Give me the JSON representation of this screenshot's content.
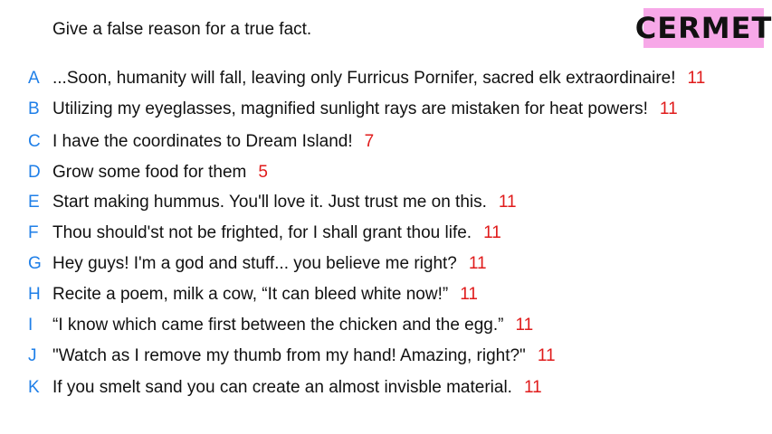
{
  "prompt": "Give a false reason for a true fact.",
  "badge": "CERMET",
  "colors": {
    "letter": "#1f7fe8",
    "score": "#e01b1b",
    "badge_bg": "#f7a8e8"
  },
  "answers": [
    {
      "letter": "A",
      "text": "...Soon, humanity will fall, leaving only Furricus Pornifer, sacred elk extraordinaire!",
      "score": "11"
    },
    {
      "letter": "B",
      "text": "Utilizing my eyeglasses, magnified sunlight rays are mistaken for heat powers!",
      "score": "11"
    },
    {
      "letter": "C",
      "text": "I have the coordinates to Dream Island!",
      "score": "7"
    },
    {
      "letter": "D",
      "text": "Grow some food for them",
      "score": "5"
    },
    {
      "letter": "E",
      "text": "Start making hummus. You'll love it. Just trust me on this.",
      "score": "11"
    },
    {
      "letter": "F",
      "text": "Thou should'st not be frighted, for I shall grant thou life.",
      "score": "11"
    },
    {
      "letter": "G",
      "text": "Hey guys! I'm a god and stuff... you believe me right?",
      "score": "11"
    },
    {
      "letter": "H",
      "text": "Recite a poem, milk a cow, “It can bleed white now!”",
      "score": "11"
    },
    {
      "letter": "I",
      "text": "“I know which came first between the chicken and the egg.”",
      "score": "11"
    },
    {
      "letter": "J",
      "text": "\"Watch as I remove my thumb from my hand! Amazing, right?\"",
      "score": "11"
    },
    {
      "letter": "K",
      "text": "If you smelt sand you can create an almost invisble material.",
      "score": "11"
    }
  ]
}
